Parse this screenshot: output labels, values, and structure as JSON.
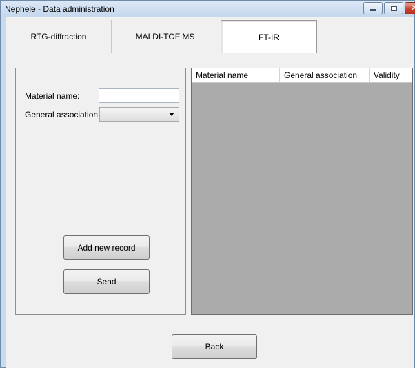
{
  "window": {
    "title": "Nephele - Data administration",
    "controls": [
      "minimize-icon",
      "maximize-icon",
      "close-icon"
    ]
  },
  "tabs": [
    {
      "label": "RTG-diffraction",
      "active": false
    },
    {
      "label": "MALDI-TOF MS",
      "active": false
    },
    {
      "label": "FT-IR",
      "active": true
    }
  ],
  "form": {
    "material_name_label": "Material name:",
    "material_name_value": "",
    "general_association_label": "General association",
    "general_association_value": "",
    "add_button": "Add new record",
    "send_button": "Send"
  },
  "grid": {
    "columns": [
      "Material name",
      "General association",
      "Validity"
    ],
    "rows": []
  },
  "footer": {
    "back_button": "Back"
  },
  "colors": {
    "grid_background": "#ababab",
    "client_background": "#f0f0f0",
    "title_bar": "#c9dcef",
    "close_button": "#c7432e"
  }
}
